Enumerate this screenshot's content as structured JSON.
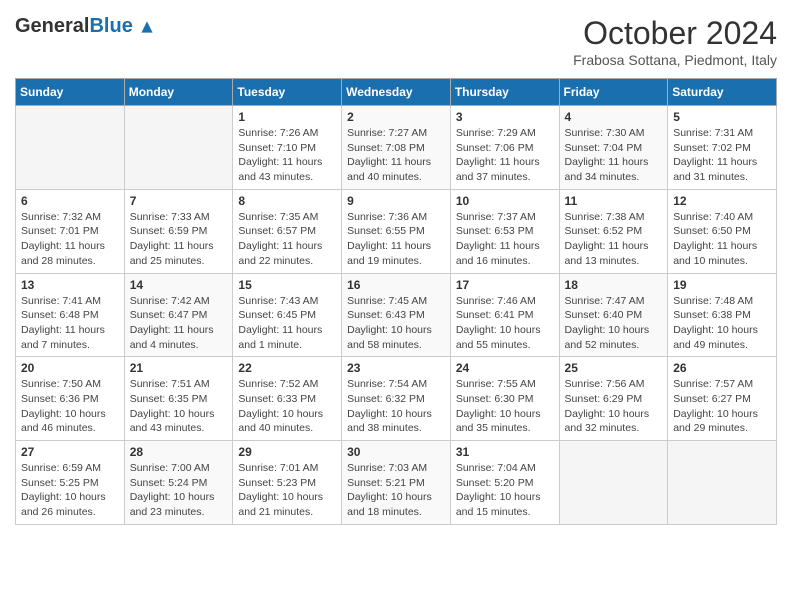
{
  "header": {
    "logo_general": "General",
    "logo_blue": "Blue",
    "month_title": "October 2024",
    "location": "Frabosa Sottana, Piedmont, Italy"
  },
  "columns": [
    "Sunday",
    "Monday",
    "Tuesday",
    "Wednesday",
    "Thursday",
    "Friday",
    "Saturday"
  ],
  "weeks": [
    [
      {
        "day": "",
        "sunrise": "",
        "sunset": "",
        "daylight": ""
      },
      {
        "day": "",
        "sunrise": "",
        "sunset": "",
        "daylight": ""
      },
      {
        "day": "1",
        "sunrise": "Sunrise: 7:26 AM",
        "sunset": "Sunset: 7:10 PM",
        "daylight": "Daylight: 11 hours and 43 minutes."
      },
      {
        "day": "2",
        "sunrise": "Sunrise: 7:27 AM",
        "sunset": "Sunset: 7:08 PM",
        "daylight": "Daylight: 11 hours and 40 minutes."
      },
      {
        "day": "3",
        "sunrise": "Sunrise: 7:29 AM",
        "sunset": "Sunset: 7:06 PM",
        "daylight": "Daylight: 11 hours and 37 minutes."
      },
      {
        "day": "4",
        "sunrise": "Sunrise: 7:30 AM",
        "sunset": "Sunset: 7:04 PM",
        "daylight": "Daylight: 11 hours and 34 minutes."
      },
      {
        "day": "5",
        "sunrise": "Sunrise: 7:31 AM",
        "sunset": "Sunset: 7:02 PM",
        "daylight": "Daylight: 11 hours and 31 minutes."
      }
    ],
    [
      {
        "day": "6",
        "sunrise": "Sunrise: 7:32 AM",
        "sunset": "Sunset: 7:01 PM",
        "daylight": "Daylight: 11 hours and 28 minutes."
      },
      {
        "day": "7",
        "sunrise": "Sunrise: 7:33 AM",
        "sunset": "Sunset: 6:59 PM",
        "daylight": "Daylight: 11 hours and 25 minutes."
      },
      {
        "day": "8",
        "sunrise": "Sunrise: 7:35 AM",
        "sunset": "Sunset: 6:57 PM",
        "daylight": "Daylight: 11 hours and 22 minutes."
      },
      {
        "day": "9",
        "sunrise": "Sunrise: 7:36 AM",
        "sunset": "Sunset: 6:55 PM",
        "daylight": "Daylight: 11 hours and 19 minutes."
      },
      {
        "day": "10",
        "sunrise": "Sunrise: 7:37 AM",
        "sunset": "Sunset: 6:53 PM",
        "daylight": "Daylight: 11 hours and 16 minutes."
      },
      {
        "day": "11",
        "sunrise": "Sunrise: 7:38 AM",
        "sunset": "Sunset: 6:52 PM",
        "daylight": "Daylight: 11 hours and 13 minutes."
      },
      {
        "day": "12",
        "sunrise": "Sunrise: 7:40 AM",
        "sunset": "Sunset: 6:50 PM",
        "daylight": "Daylight: 11 hours and 10 minutes."
      }
    ],
    [
      {
        "day": "13",
        "sunrise": "Sunrise: 7:41 AM",
        "sunset": "Sunset: 6:48 PM",
        "daylight": "Daylight: 11 hours and 7 minutes."
      },
      {
        "day": "14",
        "sunrise": "Sunrise: 7:42 AM",
        "sunset": "Sunset: 6:47 PM",
        "daylight": "Daylight: 11 hours and 4 minutes."
      },
      {
        "day": "15",
        "sunrise": "Sunrise: 7:43 AM",
        "sunset": "Sunset: 6:45 PM",
        "daylight": "Daylight: 11 hours and 1 minute."
      },
      {
        "day": "16",
        "sunrise": "Sunrise: 7:45 AM",
        "sunset": "Sunset: 6:43 PM",
        "daylight": "Daylight: 10 hours and 58 minutes."
      },
      {
        "day": "17",
        "sunrise": "Sunrise: 7:46 AM",
        "sunset": "Sunset: 6:41 PM",
        "daylight": "Daylight: 10 hours and 55 minutes."
      },
      {
        "day": "18",
        "sunrise": "Sunrise: 7:47 AM",
        "sunset": "Sunset: 6:40 PM",
        "daylight": "Daylight: 10 hours and 52 minutes."
      },
      {
        "day": "19",
        "sunrise": "Sunrise: 7:48 AM",
        "sunset": "Sunset: 6:38 PM",
        "daylight": "Daylight: 10 hours and 49 minutes."
      }
    ],
    [
      {
        "day": "20",
        "sunrise": "Sunrise: 7:50 AM",
        "sunset": "Sunset: 6:36 PM",
        "daylight": "Daylight: 10 hours and 46 minutes."
      },
      {
        "day": "21",
        "sunrise": "Sunrise: 7:51 AM",
        "sunset": "Sunset: 6:35 PM",
        "daylight": "Daylight: 10 hours and 43 minutes."
      },
      {
        "day": "22",
        "sunrise": "Sunrise: 7:52 AM",
        "sunset": "Sunset: 6:33 PM",
        "daylight": "Daylight: 10 hours and 40 minutes."
      },
      {
        "day": "23",
        "sunrise": "Sunrise: 7:54 AM",
        "sunset": "Sunset: 6:32 PM",
        "daylight": "Daylight: 10 hours and 38 minutes."
      },
      {
        "day": "24",
        "sunrise": "Sunrise: 7:55 AM",
        "sunset": "Sunset: 6:30 PM",
        "daylight": "Daylight: 10 hours and 35 minutes."
      },
      {
        "day": "25",
        "sunrise": "Sunrise: 7:56 AM",
        "sunset": "Sunset: 6:29 PM",
        "daylight": "Daylight: 10 hours and 32 minutes."
      },
      {
        "day": "26",
        "sunrise": "Sunrise: 7:57 AM",
        "sunset": "Sunset: 6:27 PM",
        "daylight": "Daylight: 10 hours and 29 minutes."
      }
    ],
    [
      {
        "day": "27",
        "sunrise": "Sunrise: 6:59 AM",
        "sunset": "Sunset: 5:25 PM",
        "daylight": "Daylight: 10 hours and 26 minutes."
      },
      {
        "day": "28",
        "sunrise": "Sunrise: 7:00 AM",
        "sunset": "Sunset: 5:24 PM",
        "daylight": "Daylight: 10 hours and 23 minutes."
      },
      {
        "day": "29",
        "sunrise": "Sunrise: 7:01 AM",
        "sunset": "Sunset: 5:23 PM",
        "daylight": "Daylight: 10 hours and 21 minutes."
      },
      {
        "day": "30",
        "sunrise": "Sunrise: 7:03 AM",
        "sunset": "Sunset: 5:21 PM",
        "daylight": "Daylight: 10 hours and 18 minutes."
      },
      {
        "day": "31",
        "sunrise": "Sunrise: 7:04 AM",
        "sunset": "Sunset: 5:20 PM",
        "daylight": "Daylight: 10 hours and 15 minutes."
      },
      {
        "day": "",
        "sunrise": "",
        "sunset": "",
        "daylight": ""
      },
      {
        "day": "",
        "sunrise": "",
        "sunset": "",
        "daylight": ""
      }
    ]
  ]
}
